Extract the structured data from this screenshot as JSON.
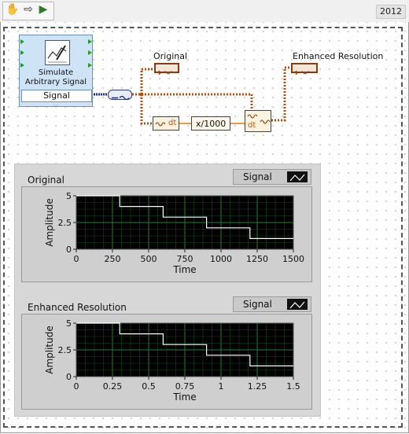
{
  "app": {
    "version_badge": "2012",
    "tools": [
      {
        "name": "hand-icon",
        "glyph": "✋"
      },
      {
        "name": "arrow-right-icon",
        "glyph": "⇨"
      },
      {
        "name": "run-arrow-icon",
        "glyph": "▶"
      }
    ]
  },
  "diagram": {
    "simulate_node": {
      "line1": "Simulate",
      "line2": "Arbitrary Signal",
      "output_label": "Signal",
      "expand_glyph": "⌵"
    },
    "original_indicator": "Original",
    "enhanced_indicator": "Enhanced Resolution",
    "dt_label": "dt",
    "scale_label": "x/1000",
    "dt_set_label": "dt",
    "wire_color": "#b05010",
    "indicator_border_color": "#8a3a10"
  },
  "graphs": [
    {
      "title": "Original",
      "legend": "Signal",
      "chart_data": {
        "type": "line",
        "title": "Original",
        "xlabel": "Time",
        "ylabel": "Amplitude",
        "xlim": [
          0,
          1500
        ],
        "ylim": [
          0,
          5
        ],
        "xticks": [
          "0",
          "250",
          "500",
          "750",
          "1000",
          "1250",
          "1500"
        ],
        "yticks": [
          "0",
          "2.5",
          "5"
        ],
        "series": [
          {
            "name": "Signal",
            "step": true,
            "x": [
              0,
              300,
              600,
              900,
              1200,
              1500
            ],
            "y": [
              5,
              4,
              3,
              2,
              1,
              1
            ]
          }
        ]
      }
    },
    {
      "title": "Enhanced Resolution",
      "legend": "Signal",
      "chart_data": {
        "type": "line",
        "title": "Enhanced Resolution",
        "xlabel": "Time",
        "ylabel": "Amplitude",
        "xlim": [
          0,
          1.5
        ],
        "ylim": [
          0,
          5
        ],
        "xticks": [
          "0",
          "0.25",
          "0.5",
          "0.75",
          "1",
          "1.25",
          "1.5"
        ],
        "yticks": [
          "0",
          "2.5",
          "5"
        ],
        "series": [
          {
            "name": "Signal",
            "step": true,
            "x": [
              0,
              0.3,
              0.6,
              0.9,
              1.2,
              1.5
            ],
            "y": [
              5,
              4,
              3,
              2,
              1,
              1
            ]
          }
        ]
      }
    }
  ]
}
